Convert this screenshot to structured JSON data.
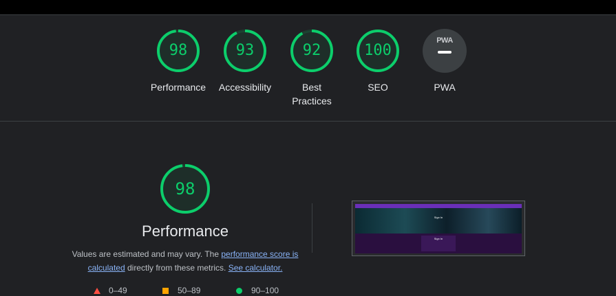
{
  "categories": [
    {
      "id": "performance",
      "label": "Performance",
      "score": "98",
      "fraction": 0.98
    },
    {
      "id": "accessibility",
      "label": "Accessibility",
      "score": "93",
      "fraction": 0.93
    },
    {
      "id": "best-practices",
      "label": "Best\nPractices",
      "score": "92",
      "fraction": 0.92
    },
    {
      "id": "seo",
      "label": "SEO",
      "score": "100",
      "fraction": 1.0
    },
    {
      "id": "pwa",
      "label": "PWA",
      "badge_text": "PWA"
    }
  ],
  "performance": {
    "score": "98",
    "fraction": 0.98,
    "title": "Performance",
    "desc_prefix": "Values are estimated and may vary. The ",
    "link_score": "performance score is calculated",
    "desc_middle": " directly from these metrics. ",
    "link_calculator": "See calculator."
  },
  "screenshot": {
    "hero_title": "Sign In",
    "card_title": "Sign In"
  },
  "legend": [
    {
      "shape": "triangle",
      "label": "0–49",
      "color": "#ff4e42"
    },
    {
      "shape": "square",
      "label": "50–89",
      "color": "#ffa400"
    },
    {
      "shape": "circle",
      "label": "90–100",
      "color": "#0cce6b"
    }
  ],
  "colors": {
    "pass": "#0cce6b",
    "background": "#202124",
    "link": "#8ab4f8"
  }
}
